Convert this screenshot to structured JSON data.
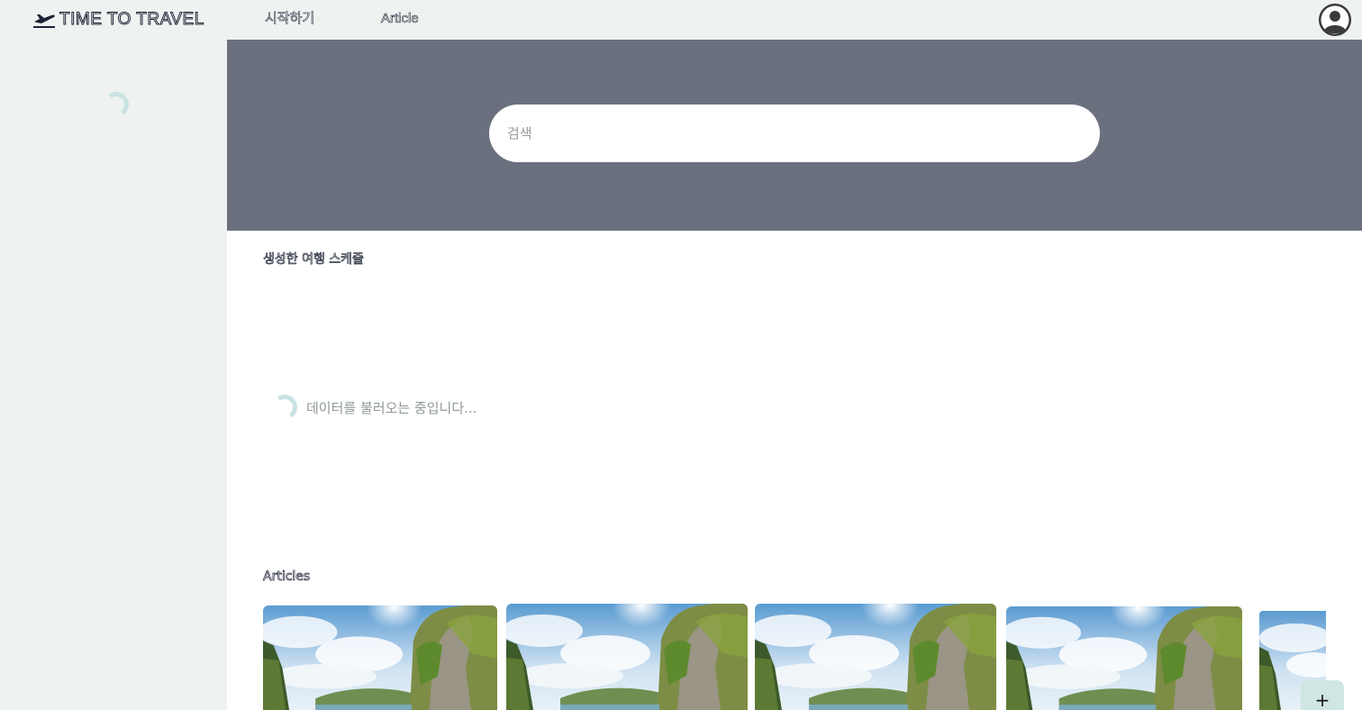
{
  "nav": {
    "logo_text": "TIME TO TRAVEL",
    "links": [
      "시작하기",
      "Article"
    ]
  },
  "search": {
    "placeholder": "검색"
  },
  "schedule": {
    "title": "생성한 여행 스케줄",
    "loading_text": "데이터를 불러오는 중입니다..."
  },
  "articles": {
    "title": "Articles",
    "card_count": 5
  },
  "fab": {
    "icon": "plus-icon",
    "symbol": "+"
  },
  "colors": {
    "nav_bg": "#eef2f1",
    "hero_bg": "#6b707f",
    "spinner": "#c9e2e2",
    "fab_bg": "#cfe6e4"
  }
}
